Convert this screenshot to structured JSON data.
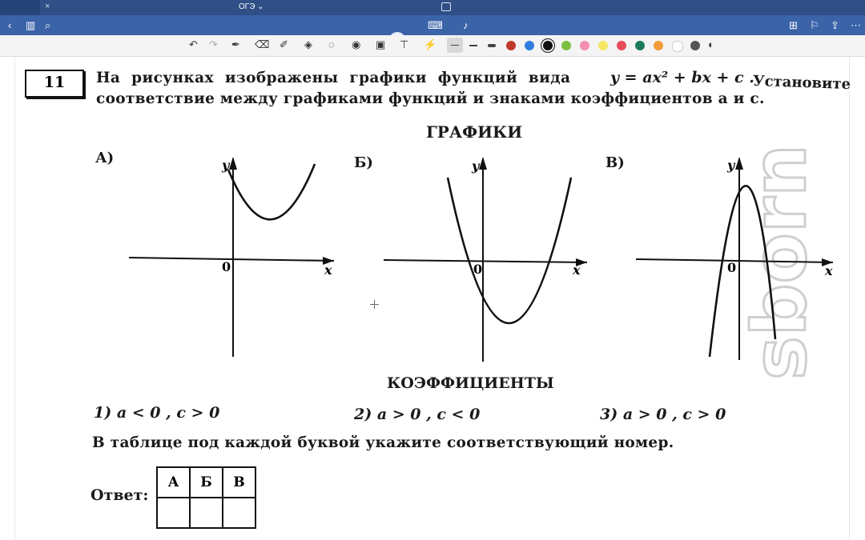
{
  "browser": {
    "tab_title": "ОГЭ ⌄",
    "tab_close": "×"
  },
  "toolbar": {
    "colors": [
      "#c0392b",
      "#2f7de1",
      "#111111",
      "#7bc043",
      "#f48fb1",
      "#f5e663",
      "#e84b5c",
      "#1e7b5a",
      "#f29b38",
      "#ffffff",
      "#555555"
    ]
  },
  "task": {
    "number": "11",
    "line1_a": "На рисунках изображены графики функций вида",
    "formula": "y = ax² + bx + c .",
    "line1_b": "Установите",
    "line2": "соответствие между графиками функций и знаками коэффициентов a и c.",
    "graphs_heading": "ГРАФИКИ",
    "graph_labels": [
      "А)",
      "Б)",
      "В)"
    ],
    "axis_y": "y",
    "axis_x": "x",
    "origin": "0",
    "coef_heading": "КОЭФФИЦИЕНТЫ",
    "options": [
      "1)  a < 0 ,  c > 0",
      "2)  a > 0 ,  c < 0",
      "3)  a > 0 ,  c > 0"
    ],
    "instruction": "В таблице под каждой буквой укажите соответствующий номер.",
    "answer_label": "Ответ:",
    "table_headers": [
      "А",
      "Б",
      "В"
    ]
  },
  "watermark": "sborn"
}
